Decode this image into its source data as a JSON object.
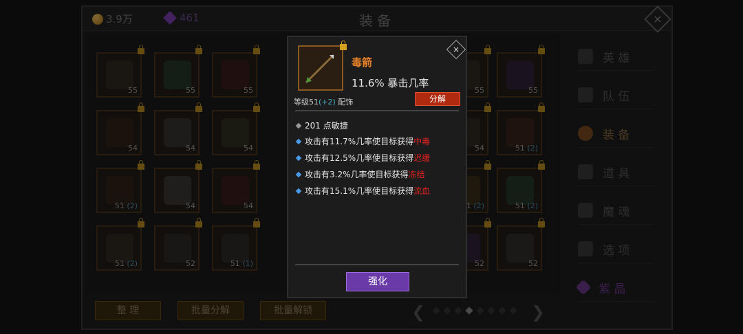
{
  "header": {
    "gold": "3.9万",
    "gems": "461",
    "title": "装备"
  },
  "slots": [
    {
      "level": "55",
      "bonus": ""
    },
    {
      "level": "55",
      "bonus": ""
    },
    {
      "level": "55",
      "bonus": ""
    },
    {
      "level": "55",
      "bonus": ""
    },
    {
      "level": "55",
      "bonus": ""
    },
    {
      "level": "54",
      "bonus": ""
    },
    {
      "level": "54",
      "bonus": ""
    },
    {
      "level": "51",
      "bonus": "(2)"
    },
    {
      "level": "51",
      "bonus": "(2)"
    },
    {
      "level": "54",
      "bonus": ""
    },
    {
      "level": "54",
      "bonus": ""
    },
    {
      "level": "51",
      "bonus": "(2)"
    },
    {
      "level": "51",
      "bonus": "(2)"
    },
    {
      "level": "52",
      "bonus": ""
    },
    {
      "level": "51",
      "bonus": "(1)"
    },
    {
      "level": "52",
      "bonus": ""
    },
    {
      "level": "52",
      "bonus": ""
    }
  ],
  "bottom_buttons": {
    "sort": "整 理",
    "batch_decompose": "批量分解",
    "batch_unlock": "批量解锁"
  },
  "sidebar": [
    {
      "label": "英 雄",
      "icon": "hero-icon"
    },
    {
      "label": "队 伍",
      "icon": "flag-icon"
    },
    {
      "label": "装 备",
      "icon": "helmet-icon"
    },
    {
      "label": "道 具",
      "icon": "bag-icon"
    },
    {
      "label": "魔 魂",
      "icon": "flame-icon"
    },
    {
      "label": "选 项",
      "icon": "gear-icon"
    },
    {
      "label": "紫 晶",
      "icon": "crystal-icon"
    }
  ],
  "popup": {
    "name": "毒箭",
    "crit": "11.6% 暴击几率",
    "level_prefix": "等级51",
    "level_bonus": "(+2)",
    "type": "配饰",
    "decompose": "分解",
    "base_stat": "201 点敏捷",
    "effects": [
      {
        "text": "攻击有11.7%几率使目标获得",
        "status": "中毒"
      },
      {
        "text": "攻击有12.5%几率使目标获得",
        "status": "迟缓"
      },
      {
        "text": "攻击有3.2%几率使目标获得",
        "status": "冻结"
      },
      {
        "text": "攻击有15.1%几率使目标获得",
        "status": "流血"
      }
    ],
    "enhance": "强化"
  },
  "colors": {
    "item_name": "#e8832a",
    "effect_status": "#e02020",
    "enhance_button": "#6a3aa8",
    "decompose_button": "#b02a10"
  }
}
